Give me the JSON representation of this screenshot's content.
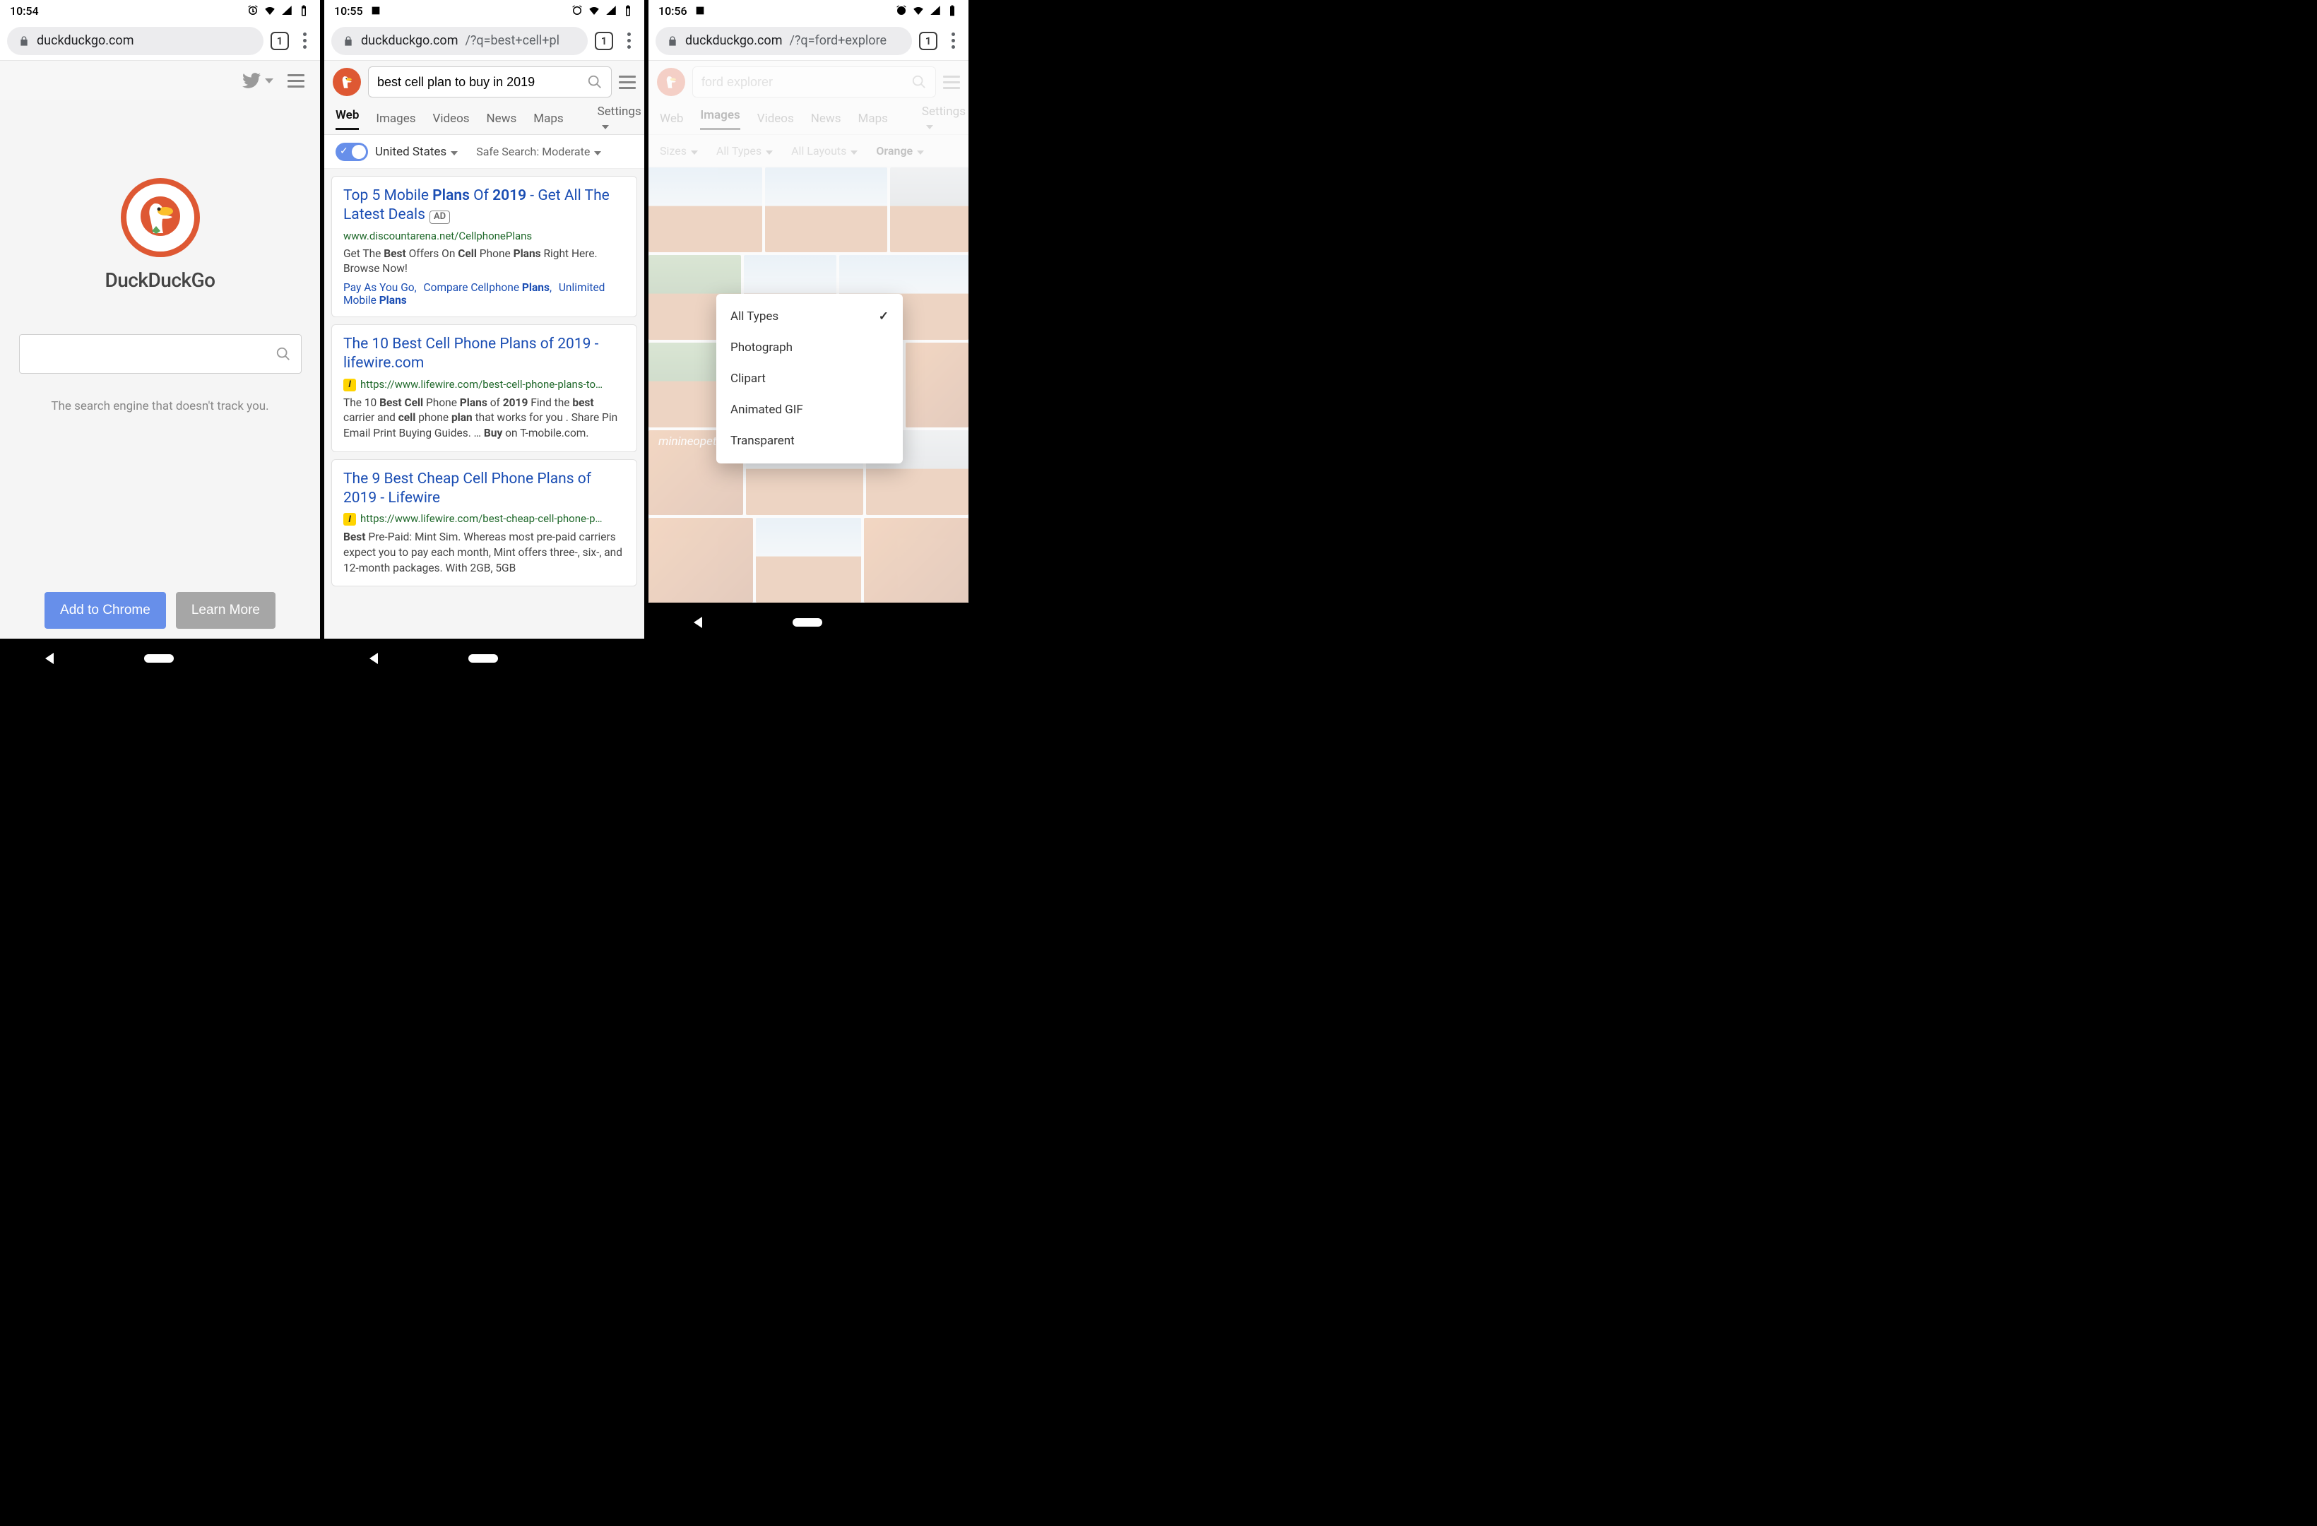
{
  "screens": [
    {
      "statusbar": {
        "time": "10:54"
      },
      "browser": {
        "url_domain": "duckduckgo.com",
        "url_rest": "",
        "tab_count": "1"
      },
      "home": {
        "brand": "DuckDuckGo",
        "tagline": "The search engine that doesn't track you.",
        "add_button": "Add to Chrome",
        "learn_button": "Learn More",
        "search_value": ""
      }
    },
    {
      "statusbar": {
        "time": "10:55"
      },
      "browser": {
        "url_domain": "duckduckgo.com",
        "url_rest": "/?q=best+cell+pl",
        "tab_count": "1"
      },
      "search": {
        "query": "best cell plan to buy in 2019"
      },
      "tabs": {
        "web": "Web",
        "images": "Images",
        "videos": "Videos",
        "news": "News",
        "maps": "Maps",
        "settings": "Settings"
      },
      "filters": {
        "region": "United States",
        "safe": "Safe Search: Moderate"
      },
      "results": [
        {
          "title_parts": [
            "Top 5 Mobile ",
            "Plans",
            " Of ",
            "2019",
            " - Get All The Latest Deals"
          ],
          "ad": true,
          "url": "www.discountarena.net/CellphonePlans",
          "snippet": "Get The Best Offers On Cell Phone Plans Right Here. Browse Now!",
          "sitelinks": [
            "Pay As You Go,",
            "Compare Cellphone Plans,",
            "Unlimited Mobile Plans"
          ]
        },
        {
          "title": "The 10 Best Cell Phone Plans of 2019 - lifewire.com",
          "favicon": "l",
          "url": "https://www.lifewire.com/best-cell-phone-plans-to…",
          "snippet": "The 10 Best Cell Phone Plans of 2019 Find the best carrier and cell phone plan that works for you . Share Pin Email Print Buying Guides. … Buy on T-mobile.com."
        },
        {
          "title": "The 9 Best Cheap Cell Phone Plans of 2019 - Lifewire",
          "favicon": "l",
          "url": "https://www.lifewire.com/best-cheap-cell-phone-p…",
          "snippet": "Best Pre-Paid: Mint Sim. Whereas most pre-paid carriers expect you to pay each month, Mint offers three-, six-, and 12-month packages. With 2GB, 5GB"
        }
      ]
    },
    {
      "statusbar": {
        "time": "10:56"
      },
      "browser": {
        "url_domain": "duckduckgo.com",
        "url_rest": "/?q=ford+explore",
        "tab_count": "1"
      },
      "search": {
        "query": "ford explorer"
      },
      "tabs": {
        "web": "Web",
        "images": "Images",
        "videos": "Videos",
        "news": "News",
        "maps": "Maps",
        "settings": "Settings"
      },
      "img_filters": {
        "sizes": "Sizes",
        "types": "All Types",
        "layouts": "All Layouts",
        "color": "Orange"
      },
      "watermark": "minineopet",
      "popup": {
        "items": [
          "All Types",
          "Photograph",
          "Clipart",
          "Animated GIF",
          "Transparent"
        ],
        "selected": "All Types"
      }
    }
  ]
}
